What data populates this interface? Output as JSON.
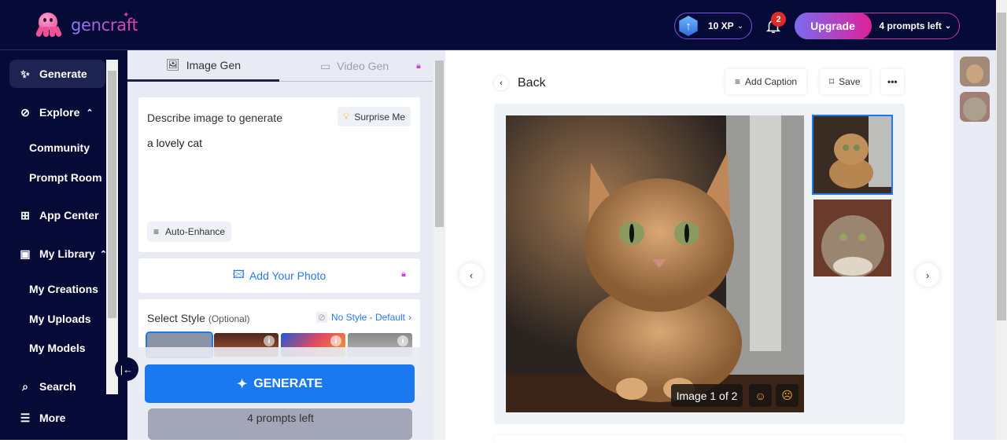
{
  "app": {
    "brand": "gencraft"
  },
  "header": {
    "xp_label": "10 XP",
    "notification_count": "2",
    "upgrade_label": "Upgrade",
    "prompts_left_label": "4 prompts left"
  },
  "sidebar": {
    "items": [
      {
        "label": "Generate",
        "icon": "sparkles-icon",
        "active": true
      },
      {
        "label": "Explore",
        "icon": "compass-icon",
        "expanded": true
      },
      {
        "label": "Community",
        "sub": true
      },
      {
        "label": "Prompt Room",
        "sub": true
      },
      {
        "label": "App Center",
        "icon": "apps-grid-icon"
      },
      {
        "label": "My Library",
        "icon": "library-icon",
        "expanded": true
      },
      {
        "label": "My Creations",
        "sub": true
      },
      {
        "label": "My Uploads",
        "sub": true
      },
      {
        "label": "My Models",
        "sub": true
      },
      {
        "label": "Search",
        "icon": "search-icon"
      },
      {
        "label": "More",
        "icon": "menu-icon"
      }
    ]
  },
  "panel": {
    "tabs": [
      {
        "label": "Image Gen",
        "active": true
      },
      {
        "label": "Video Gen",
        "locked": true
      }
    ],
    "prompt_label": "Describe image to generate",
    "surprise_label": "Surprise Me",
    "prompt_value": "a lovely cat",
    "auto_enhance_label": "Auto-Enhance",
    "add_photo_label": "Add Your Photo",
    "select_style_label": "Select Style",
    "select_style_optional": "(Optional)",
    "style_value": "No Style - Default",
    "generate_label": "GENERATE",
    "prompts_left": "4 prompts left"
  },
  "main": {
    "back_label": "Back",
    "add_caption_label": "Add Caption",
    "save_label": "Save",
    "image_counter": "Image 1 of 2",
    "current_image": 1,
    "total_images": 2,
    "accent": "#1a78f0"
  }
}
